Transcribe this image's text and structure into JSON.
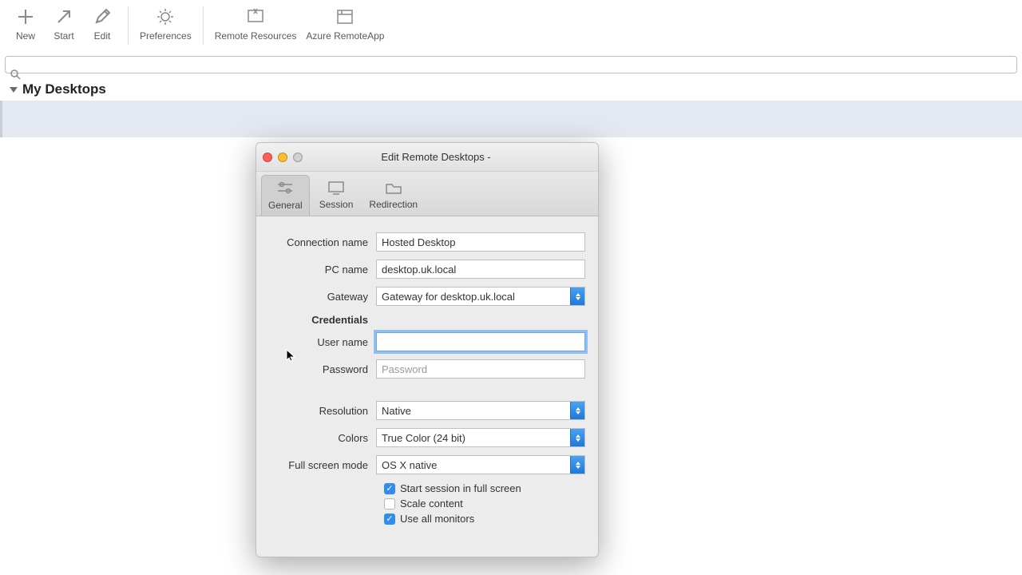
{
  "toolbar": {
    "new": "New",
    "start": "Start",
    "edit": "Edit",
    "preferences": "Preferences",
    "remote_resources": "Remote Resources",
    "azure_remoteapp": "Azure RemoteApp"
  },
  "search": {
    "placeholder": ""
  },
  "section": {
    "title": "My Desktops"
  },
  "window": {
    "title": "Edit Remote Desktops -",
    "tabs": {
      "general": "General",
      "session": "Session",
      "redirection": "Redirection"
    }
  },
  "form": {
    "labels": {
      "connection_name": "Connection name",
      "pc_name": "PC name",
      "gateway": "Gateway",
      "credentials": "Credentials",
      "user_name": "User name",
      "password": "Password",
      "resolution": "Resolution",
      "colors": "Colors",
      "full_screen_mode": "Full screen mode"
    },
    "values": {
      "connection_name": "Hosted Desktop",
      "pc_name": "desktop.uk.local",
      "gateway": "Gateway for desktop.uk.local",
      "user_name": "",
      "password_placeholder": "Password",
      "resolution": "Native",
      "colors": "True Color (24 bit)",
      "full_screen_mode": "OS X native"
    },
    "checks": {
      "start_full_screen": {
        "label": "Start session in full screen",
        "checked": true
      },
      "scale_content": {
        "label": "Scale content",
        "checked": false
      },
      "use_all_monitors": {
        "label": "Use all monitors",
        "checked": true
      }
    }
  }
}
